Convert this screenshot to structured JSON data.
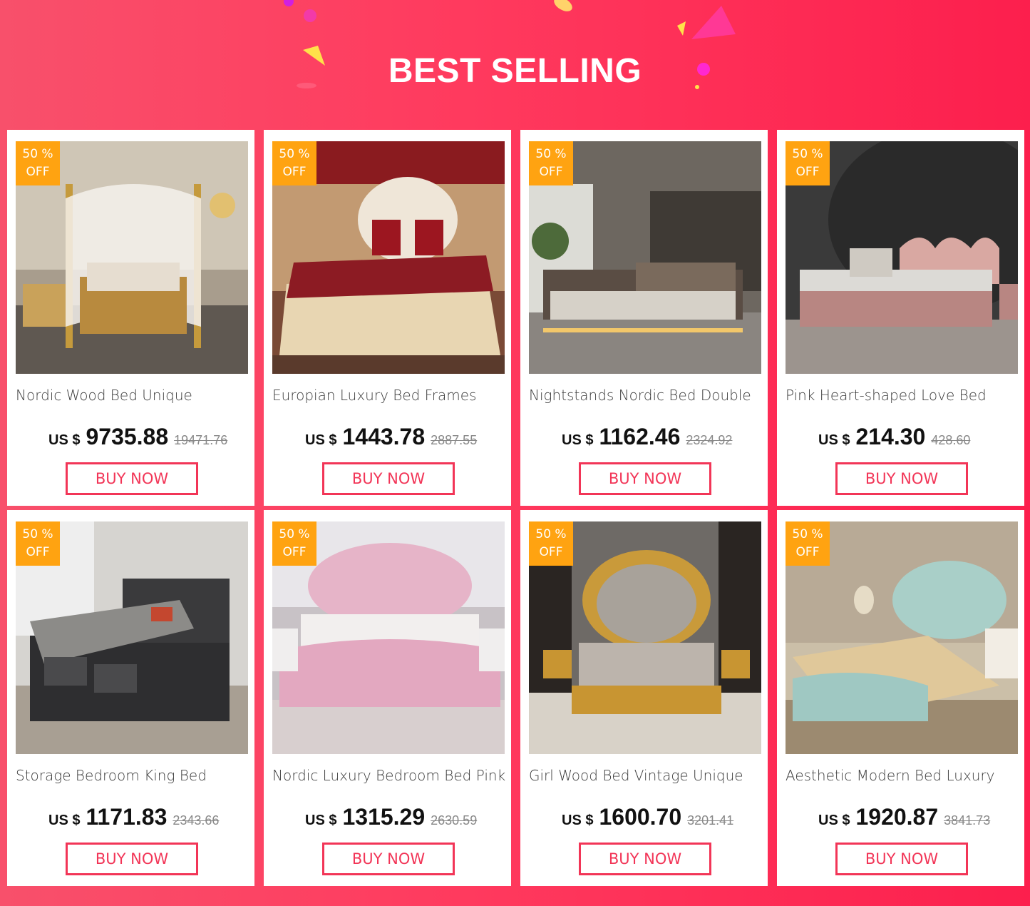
{
  "header": {
    "title": "BEST SELLING"
  },
  "products": [
    {
      "name": "Nordic Wood Bed Unique",
      "currency": "US $",
      "price": "9735.88",
      "original_price": "19471.76",
      "discount_line1": "50 %",
      "discount_line2": "OFF",
      "buy_label": "BUY NOW"
    },
    {
      "name": "Europian Luxury Bed Frames",
      "currency": "US $",
      "price": "1443.78",
      "original_price": "2887.55",
      "discount_line1": "50 %",
      "discount_line2": "OFF",
      "buy_label": "BUY NOW"
    },
    {
      "name": "Nightstands Nordic Bed Double",
      "currency": "US $",
      "price": "1162.46",
      "original_price": "2324.92",
      "discount_line1": "50 %",
      "discount_line2": "OFF",
      "buy_label": "BUY NOW"
    },
    {
      "name": "Pink Heart-shaped Love Bed",
      "currency": "US $",
      "price": "214.30",
      "original_price": "428.60",
      "discount_line1": "50 %",
      "discount_line2": "OFF",
      "buy_label": "BUY NOW"
    },
    {
      "name": "Storage Bedroom King Bed",
      "currency": "US $",
      "price": "1171.83",
      "original_price": "2343.66",
      "discount_line1": "50 %",
      "discount_line2": "OFF",
      "buy_label": "BUY NOW"
    },
    {
      "name": "Nordic Luxury Bedroom Bed Pink",
      "currency": "US $",
      "price": "1315.29",
      "original_price": "2630.59",
      "discount_line1": "50 %",
      "discount_line2": "OFF",
      "buy_label": "BUY NOW"
    },
    {
      "name": "Girl Wood Bed Vintage Unique",
      "currency": "US $",
      "price": "1600.70",
      "original_price": "3201.41",
      "discount_line1": "50 %",
      "discount_line2": "OFF",
      "buy_label": "BUY NOW"
    },
    {
      "name": "Aesthetic Modern Bed Luxury",
      "currency": "US $",
      "price": "1920.87",
      "original_price": "3841.73",
      "discount_line1": "50 %",
      "discount_line2": "OFF",
      "buy_label": "BUY NOW"
    }
  ],
  "colors": {
    "accent": "#f23557",
    "badge": "#ffa311",
    "background": "#ff3a5e"
  }
}
